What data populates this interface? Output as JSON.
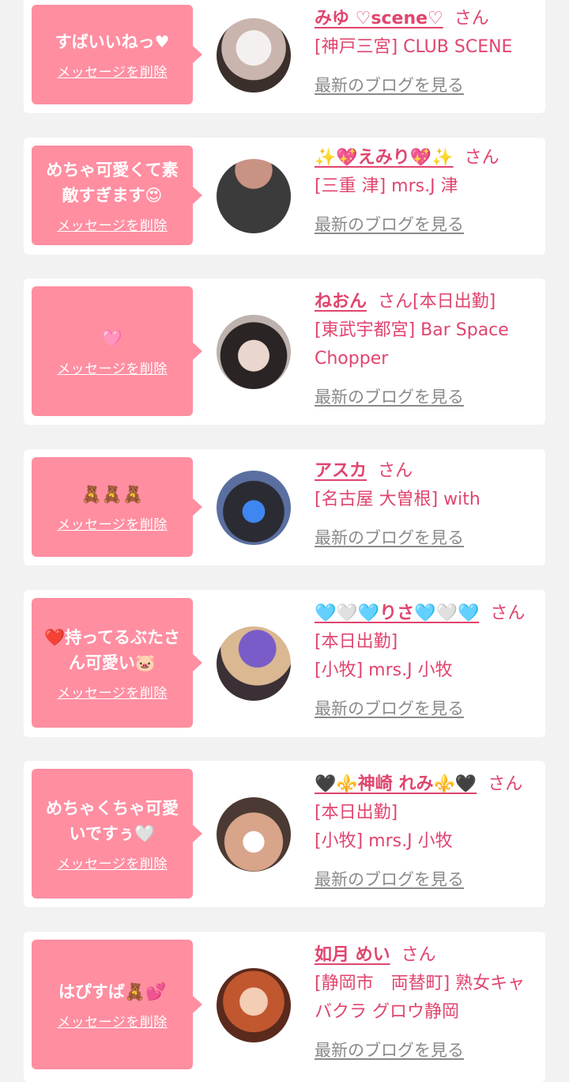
{
  "common": {
    "delete_label": "メッセージを削除",
    "san": "さん",
    "blog_label": "最新のブログを見る"
  },
  "items": [
    {
      "message": "すばいいねっ♥",
      "name": "みゆ ♡scene♡",
      "status": "",
      "shop": "[神戸三宮] CLUB SCENE"
    },
    {
      "message": "めちゃ可愛くて素敵すぎます😍",
      "name": "✨💖えみり💖✨",
      "status": "",
      "shop": "[三重 津] mrs.J 津"
    },
    {
      "message": "🩷",
      "name": "ねおん",
      "status": "[本日出勤]",
      "shop": "[東武宇都宮] Bar Space Chopper"
    },
    {
      "message": "🧸🧸🧸",
      "name": "アスカ",
      "status": "",
      "shop": "[名古屋 大曽根] with"
    },
    {
      "message": "❤️持ってるぶたさん可愛い🐷",
      "name": "🩵🤍🩵りさ🩵🤍🩵",
      "status": "[本日出勤]",
      "shop": "[小牧] mrs.J 小牧"
    },
    {
      "message": "めちゃくちゃ可愛いですぅ🤍",
      "name": "🖤⚜️神崎 れみ⚜️🖤",
      "status": "[本日出勤]",
      "shop": "[小牧] mrs.J 小牧"
    },
    {
      "message": "はぴすば🧸💕",
      "name": "如月 めい",
      "status": "",
      "shop": "[静岡市　両替町] 熟女キャバクラ グロウ静岡"
    }
  ]
}
